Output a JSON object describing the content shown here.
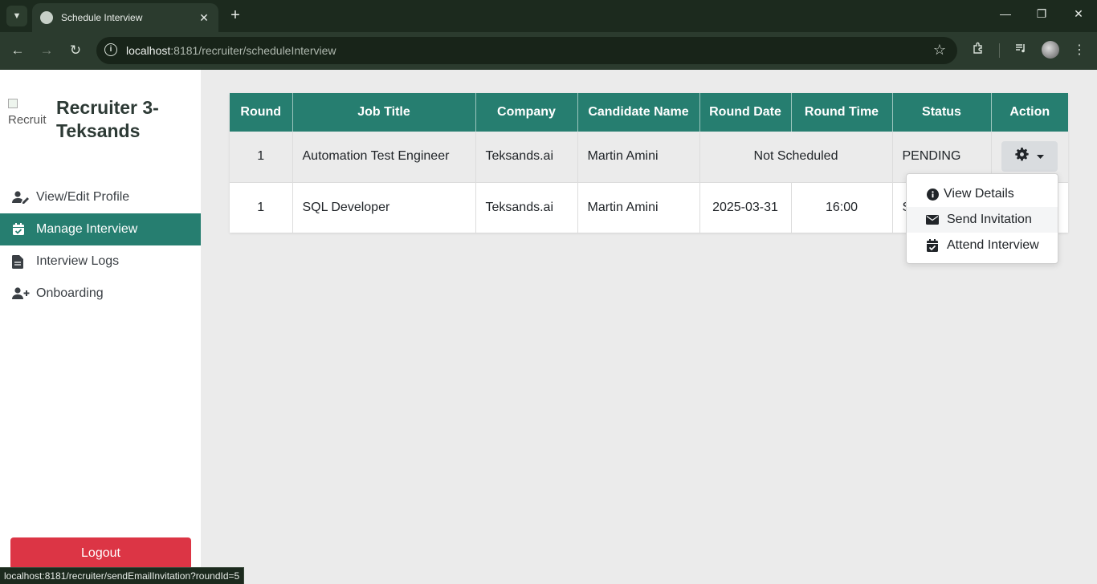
{
  "browser": {
    "tab_title": "Schedule Interview",
    "url_host": "localhost",
    "url_rest": ":8181/recruiter/scheduleInterview",
    "status_url": "localhost:8181/recruiter/sendEmailInvitation?roundId=5"
  },
  "sidebar": {
    "logo_alt": "Recruit",
    "title": "Recruiter 3-Teksands",
    "items": [
      {
        "label": "View/Edit Profile",
        "icon": "user-edit-icon"
      },
      {
        "label": "Manage Interview",
        "icon": "calendar-check-icon",
        "active": true
      },
      {
        "label": "Interview Logs",
        "icon": "file-icon"
      },
      {
        "label": "Onboarding",
        "icon": "user-plus-icon"
      }
    ],
    "logout_label": "Logout",
    "accent_color": "#267e70",
    "logout_color": "#dc3545"
  },
  "table": {
    "headers": [
      "Round",
      "Job Title",
      "Company",
      "Candidate Name",
      "Round Date",
      "Round Time",
      "Status",
      "Action"
    ],
    "rows": [
      {
        "round": "1",
        "job_title": "Automation Test Engineer",
        "company": "Teksands.ai",
        "candidate": "Martin Amini",
        "round_date_time": "Not Scheduled",
        "status": "PENDING"
      },
      {
        "round": "1",
        "job_title": "SQL Developer",
        "company": "Teksands.ai",
        "candidate": "Martin Amini",
        "round_date": "2025-03-31",
        "round_time": "16:00",
        "status": "S"
      }
    ]
  },
  "dropdown": {
    "items": [
      {
        "label": "View Details",
        "icon": "info-circle-icon"
      },
      {
        "label": "Send Invitation",
        "icon": "envelope-icon"
      },
      {
        "label": "Attend Interview",
        "icon": "calendar-check-icon"
      }
    ]
  }
}
